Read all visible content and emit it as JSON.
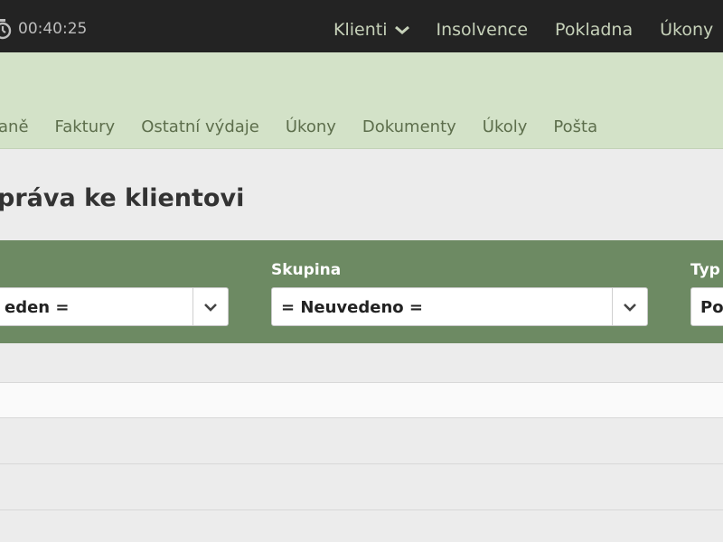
{
  "timer": {
    "value": "00:40:25",
    "icon": "stopwatch-icon"
  },
  "top_nav": {
    "klienti": "Klienti",
    "insolvence": "Insolvence",
    "pokladna": "Pokladna",
    "ukony": "Úkony"
  },
  "tabs": [
    "aně",
    "Faktury",
    "Ostatní výdaje",
    "Úkony",
    "Dokumenty",
    "Úkoly",
    "Pošta"
  ],
  "page_title": "práva ke klientovi",
  "filters": {
    "first": {
      "value": "eden ="
    },
    "skupina": {
      "label": "Skupina",
      "value": "= Neuvedeno ="
    },
    "typ": {
      "label": "Typ",
      "value": "Po"
    }
  },
  "colors": {
    "topbar": "#232323",
    "subheader": "#d3e2c8",
    "filter_band": "#6d8a63",
    "tab_text": "#5d6e4c"
  }
}
